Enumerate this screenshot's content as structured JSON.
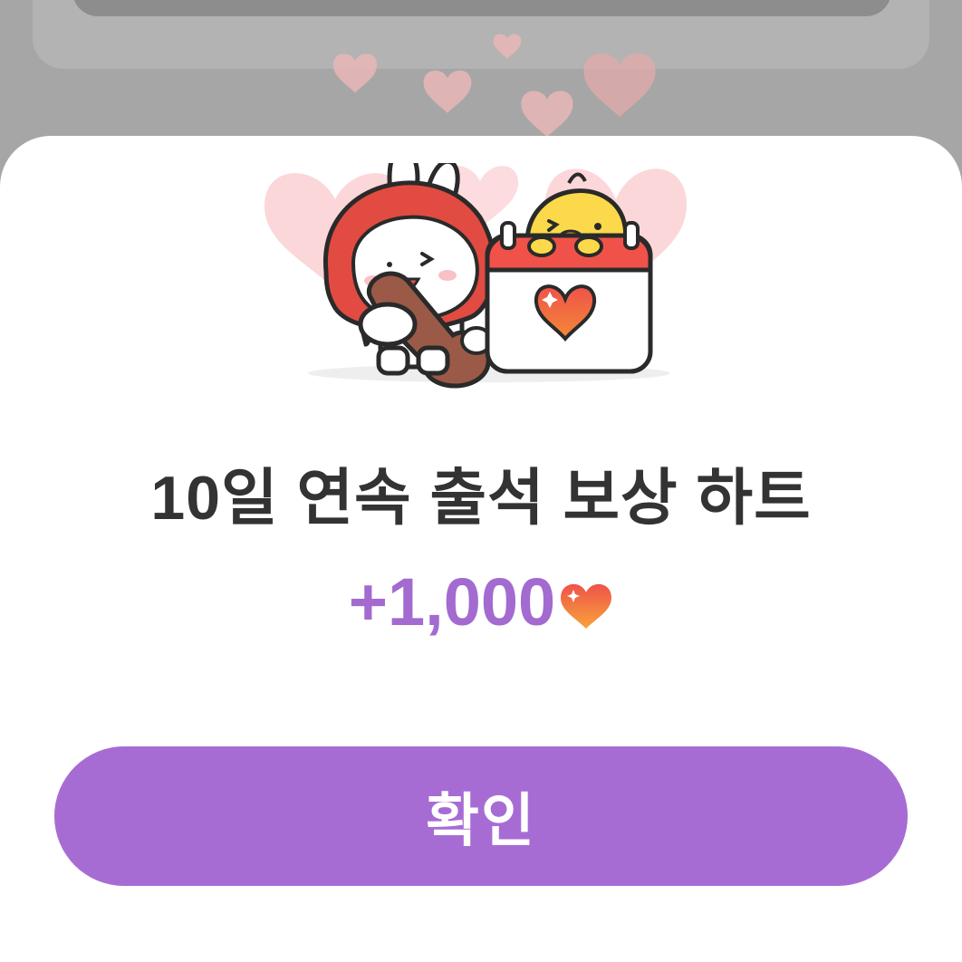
{
  "dialog": {
    "title": "10일 연속 출석 보상 하트",
    "reward_amount": "+1,000",
    "reward_icon": "heart-icon",
    "illustration": "bunny-stamping-calendar-with-chick",
    "confirm_label": "확인"
  },
  "colors": {
    "accent": "#A76CD4",
    "reward_text": "#A36AD0",
    "title_text": "#333333",
    "overlay": "#A6A6A6",
    "heart": "#F0524A"
  }
}
